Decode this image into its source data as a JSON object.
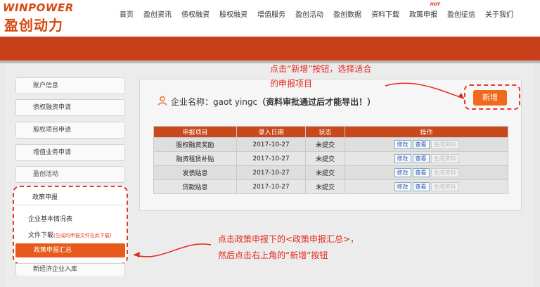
{
  "logo": {
    "en": "WINPOWER",
    "cn": "盈创动力"
  },
  "nav": [
    {
      "label": "首页"
    },
    {
      "label": "盈创资讯"
    },
    {
      "label": "债权融资"
    },
    {
      "label": "股权融资"
    },
    {
      "label": "增值服务"
    },
    {
      "label": "盈创活动"
    },
    {
      "label": "盈创数据"
    },
    {
      "label": "资料下载"
    },
    {
      "label": "政策申报",
      "badge": "HOT"
    },
    {
      "label": "盈创征信"
    },
    {
      "label": "关于我们"
    }
  ],
  "sidebar": {
    "items": [
      "账户信息",
      "债权融资申请",
      "股权项目申请",
      "增值业务申请",
      "盈创活动"
    ],
    "policy_title": "政策申报",
    "sub": {
      "basic_info": "企业基本情况表",
      "download": "文件下载",
      "download_note": "(生成的申报文件在此下载)",
      "summary": "政策申报汇总"
    },
    "last_item": "新经济企业入库"
  },
  "company": {
    "label": "企业名称：",
    "name": "gaot yingc",
    "note": "（资料审批通过后才能导出！）"
  },
  "add_button": "新增",
  "table": {
    "headers": [
      "申报项目",
      "录入日期",
      "状态",
      "操作"
    ],
    "rows": [
      {
        "project": "股权融资奖励",
        "date": "2017-10-27",
        "status": "未提交"
      },
      {
        "project": "融资租赁补贴",
        "date": "2017-10-27",
        "status": "未提交"
      },
      {
        "project": "发债贴息",
        "date": "2017-10-27",
        "status": "未提交"
      },
      {
        "project": "贷款贴息",
        "date": "2017-10-27",
        "status": "未提交"
      }
    ],
    "ops": {
      "edit": "修改",
      "view": "查看",
      "gen": "生成资料"
    }
  },
  "annotations": {
    "top_line1": "点击“新增”按钮，选择适合",
    "top_line2": "的申报项目",
    "bottom_line1": "点击政策申报下的<政策申报汇总>，",
    "bottom_line2": "然后点击右上角的“新增”按钮"
  },
  "colors": {
    "brand": "#d64a12",
    "banner": "#c7401a",
    "accent": "#ef6a1d",
    "annotation": "#e3271b"
  }
}
